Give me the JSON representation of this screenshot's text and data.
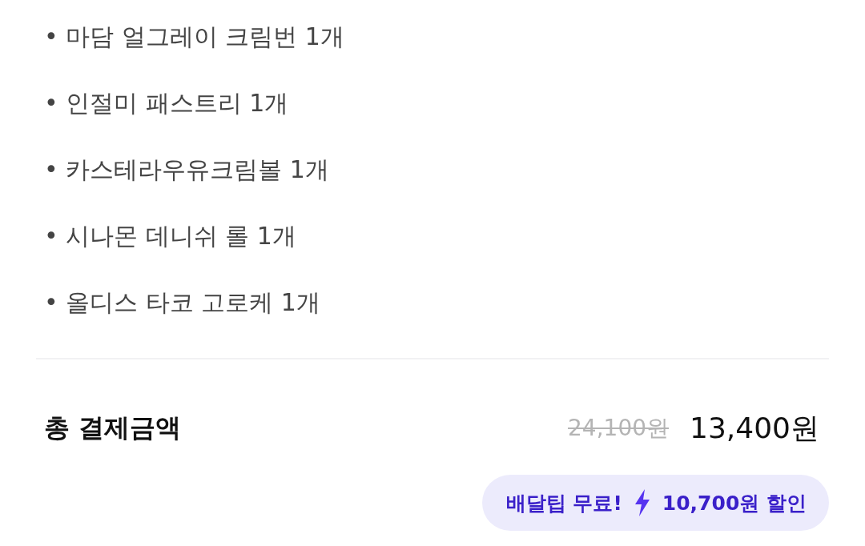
{
  "order_items": [
    "• 마담 얼그레이 크림번 1개",
    "• 인절미 패스트리 1개",
    "• 카스테라우유크림볼 1개",
    "• 시나몬 데니쉬 롤 1개",
    "• 올디스 타코 고로케 1개"
  ],
  "total": {
    "label": "총 결제금액",
    "original_price": "24,100원",
    "final_price": "13,400원"
  },
  "promo_badge": {
    "free_delivery": "배달팁 무료!",
    "discount": "10,700원 할인"
  }
}
